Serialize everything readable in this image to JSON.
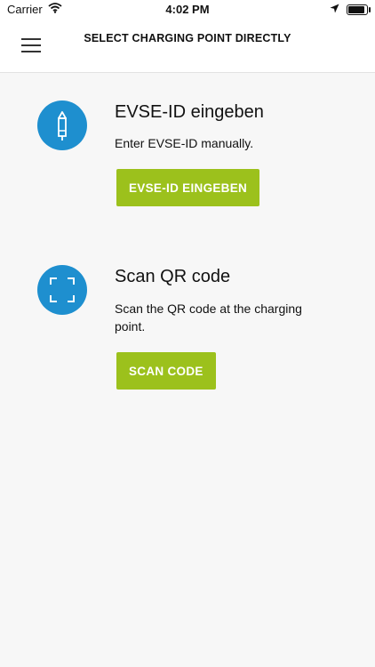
{
  "status_bar": {
    "carrier": "Carrier",
    "time": "4:02 PM",
    "icons": [
      "wifi-icon",
      "location-arrow-icon",
      "battery-icon"
    ]
  },
  "header": {
    "title": "SELECT CHARGING POINT DIRECTLY",
    "menu_icon": "hamburger-menu-icon"
  },
  "options": [
    {
      "icon": "pencil-icon",
      "title": "EVSE-ID eingeben",
      "description": "Enter EVSE-ID manually.",
      "button_label": "EVSE-ID EINGEBEN"
    },
    {
      "icon": "qr-scan-frame-icon",
      "title": "Scan QR code",
      "description": "Scan the QR code at the charging point.",
      "button_label": "SCAN CODE"
    }
  ],
  "colors": {
    "accent_blue": "#1e8fcf",
    "button_green": "#9cc11c",
    "background": "#f7f7f7",
    "header_background": "#ffffff"
  }
}
